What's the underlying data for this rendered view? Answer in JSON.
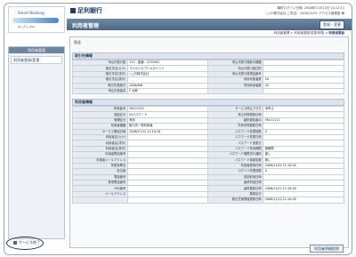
{
  "app": {
    "bank_name": "足利銀行",
    "left_brand_line1": "Smart Banking",
    "left_brand_line2": "あしぎん Web"
  },
  "header": {
    "meta_line1": "最終ログイン日時: 2008年11月12日 14:11:11",
    "meta_line2": "○△口株式会社 ご担当：2008/12/01 アクセス管理者 様",
    "page_title": "利用者管理",
    "top_button": "登録・変更"
  },
  "breadcrumbs": {
    "items": [
      "利用者管理",
      "利用者登録/変更/削除",
      "利用者照会"
    ]
  },
  "left_nav": {
    "header": "利用者管理",
    "items": [
      "利用者登録/変更"
    ],
    "logout": "サービス終了"
  },
  "content": {
    "label": "照会",
    "section1_title": "取引先情報",
    "section1_rows": [
      [
        "申込代表口座",
        "123 - 普通 - 1234567",
        "申込代表口座取引種類",
        ""
      ],
      [
        "取引先名(カナ)",
        "マルサンカブシキガイシャ",
        "申込代表口座住所",
        ""
      ],
      [
        "取引先名(漢字)",
        "○△口株式会社",
        "申込代表口座電話番号",
        ""
      ],
      [
        "取引先名(英字)",
        "",
        "利用可能者数",
        "20"
      ],
      [
        "取引先登録日",
        "2008/6/6",
        "有効利用者数",
        "20"
      ],
      [
        "申込代表者名",
        "F 太郎",
        "",
        ""
      ]
    ],
    "section2_title": "利用者情報",
    "section2_rows": [
      [
        "利用者ID",
        "FB222222",
        "サービス停止フラグ",
        "未停止"
      ],
      [
        "認証区分",
        "IDパスワード",
        "停止状態更新日時",
        ""
      ],
      [
        "管理区分",
        "有効",
        "最終更新者ID",
        "FB111111"
      ],
      [
        "利用者種類",
        "取引先一般利用者",
        "失効状態更新日時",
        ""
      ],
      [
        "サービス開始日時",
        "2008/11/12 11:10:16",
        "パスワード変更回数",
        "0"
      ],
      [
        "利用者名(カナ)",
        "",
        "パスワード変更日時",
        ""
      ],
      [
        "利用者名(漢字)",
        "",
        "パスワード変更日",
        ""
      ],
      [
        "利用者名(英字)",
        "",
        "パスワード有効期限",
        "無期限"
      ],
      [
        "利用者電話番号",
        "",
        "パスワード期限切れ通知",
        "無し"
      ],
      [
        "利用者メールアドレス",
        "",
        "パスワード強制変更",
        "無し"
      ],
      [
        "所属部署名",
        "",
        "利用者登録日時",
        "2008/11/12 11:10:16"
      ],
      [
        "担当者",
        "",
        "ログイン失敗回数",
        "0"
      ],
      [
        "電話番号",
        "",
        "前回利用日時",
        ""
      ],
      [
        "携帯電話番号",
        "",
        "最終利用日時",
        ""
      ],
      [
        "FAX番号",
        "",
        "最終更新日時",
        "2008/11/12 11:10:16"
      ],
      [
        "メールアドレス",
        "",
        "更新区分",
        ""
      ],
      [
        "",
        "",
        "取引先管理者更新日時",
        "2008/11/12 11:10:16"
      ]
    ]
  },
  "footer": {
    "bottom_button": "利用者明細削除"
  }
}
